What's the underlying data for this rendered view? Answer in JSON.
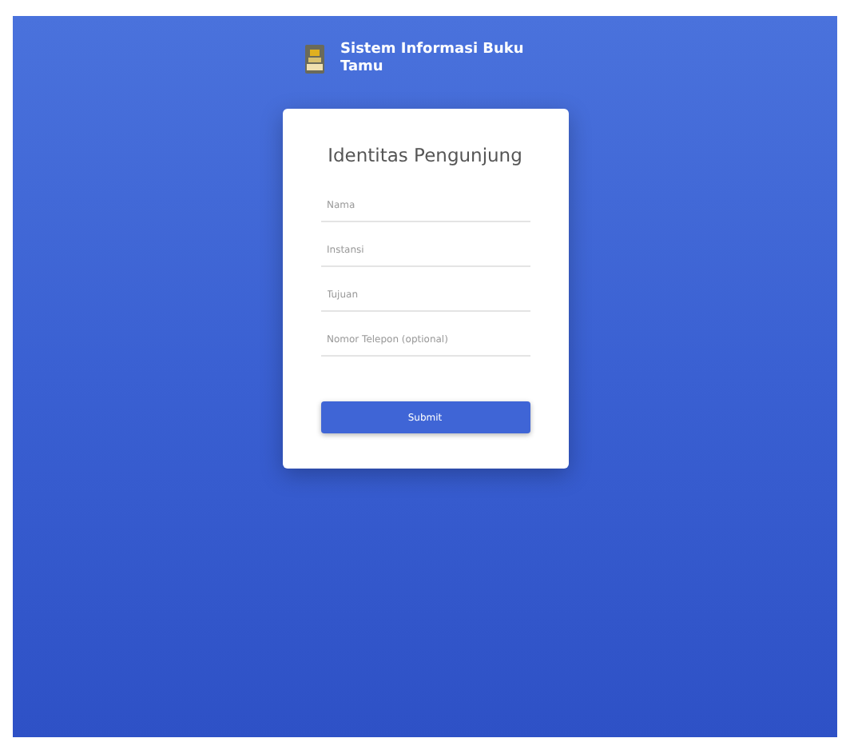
{
  "header": {
    "title": "Sistem Informasi Buku Tamu"
  },
  "form": {
    "title": "Identitas Pengunjung",
    "fields": [
      {
        "placeholder": "Nama"
      },
      {
        "placeholder": "Instansi"
      },
      {
        "placeholder": "Tujuan"
      },
      {
        "placeholder": "Nomor Telepon (optional)"
      }
    ],
    "submit": "Submit"
  }
}
